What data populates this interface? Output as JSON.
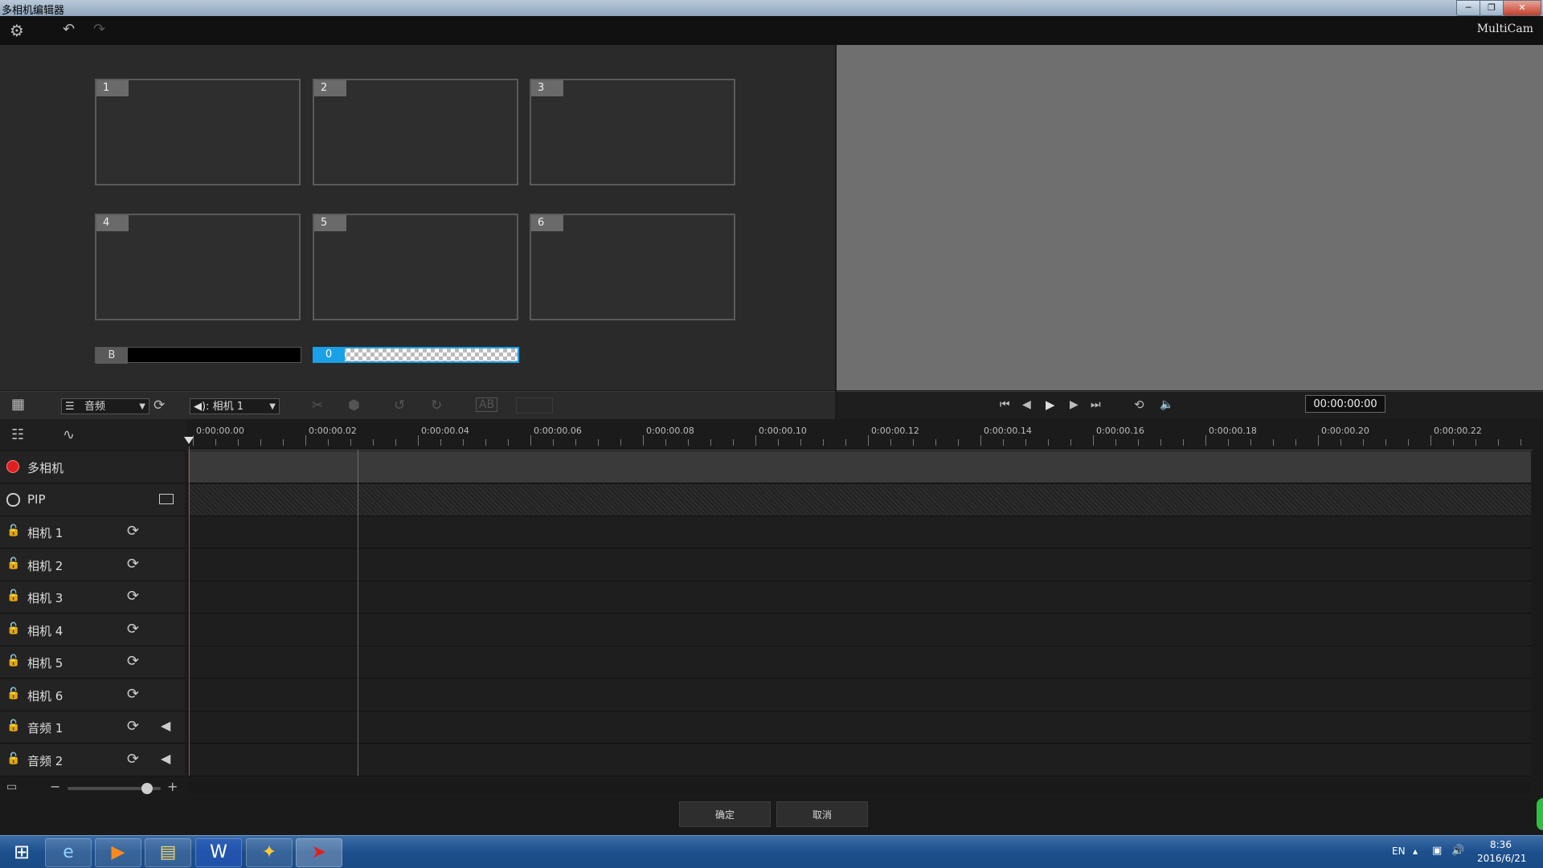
{
  "window": {
    "title": "多相机编辑器",
    "app_name": "MultiCam",
    "min": "─",
    "restore": "❐",
    "close": "✕"
  },
  "toolbar": {
    "settings_icon": "gear-icon",
    "undo_icon": "undo-icon",
    "redo_icon": "redo-icon"
  },
  "cameras": [
    {
      "num": "1"
    },
    {
      "num": "2"
    },
    {
      "num": "3"
    },
    {
      "num": "4"
    },
    {
      "num": "5"
    },
    {
      "num": "6"
    }
  ],
  "background_bar": {
    "label": "B"
  },
  "overlay_bar": {
    "label": "0"
  },
  "mid_toolbar": {
    "audio_combo": "音频",
    "camera_combo": "◀): 相机 1",
    "timecode": "00:00:00:00"
  },
  "ruler": {
    "labels": [
      "0:00:00.00",
      "0:00:00.02",
      "0:00:00.04",
      "0:00:00.06",
      "0:00:00.08",
      "0:00:00.10",
      "0:00:00.12",
      "0:00:00.14",
      "0:00:00.16",
      "0:00:00.18",
      "0:00:00.20",
      "0:00:00.22"
    ]
  },
  "tracks": [
    {
      "name": "多相机",
      "type": "multicam"
    },
    {
      "name": "PIP",
      "type": "pip"
    },
    {
      "name": "相机 1",
      "type": "camera"
    },
    {
      "name": "相机 2",
      "type": "camera"
    },
    {
      "name": "相机 3",
      "type": "camera"
    },
    {
      "name": "相机 4",
      "type": "camera"
    },
    {
      "name": "相机 5",
      "type": "camera"
    },
    {
      "name": "相机 6",
      "type": "camera"
    },
    {
      "name": "音频 1",
      "type": "audio"
    },
    {
      "name": "音频 2",
      "type": "audio"
    }
  ],
  "zoom": {
    "minus": "−",
    "plus": "+",
    "level": 0.85
  },
  "buttons": {
    "ok": "确定",
    "cancel": "取消"
  },
  "taskbar": {
    "lang": "EN",
    "time": "8:36",
    "date": "2016/6/21"
  },
  "colors": {
    "accent": "#1aa0e6",
    "record": "#e02020",
    "playhead": "#d23a3a"
  }
}
